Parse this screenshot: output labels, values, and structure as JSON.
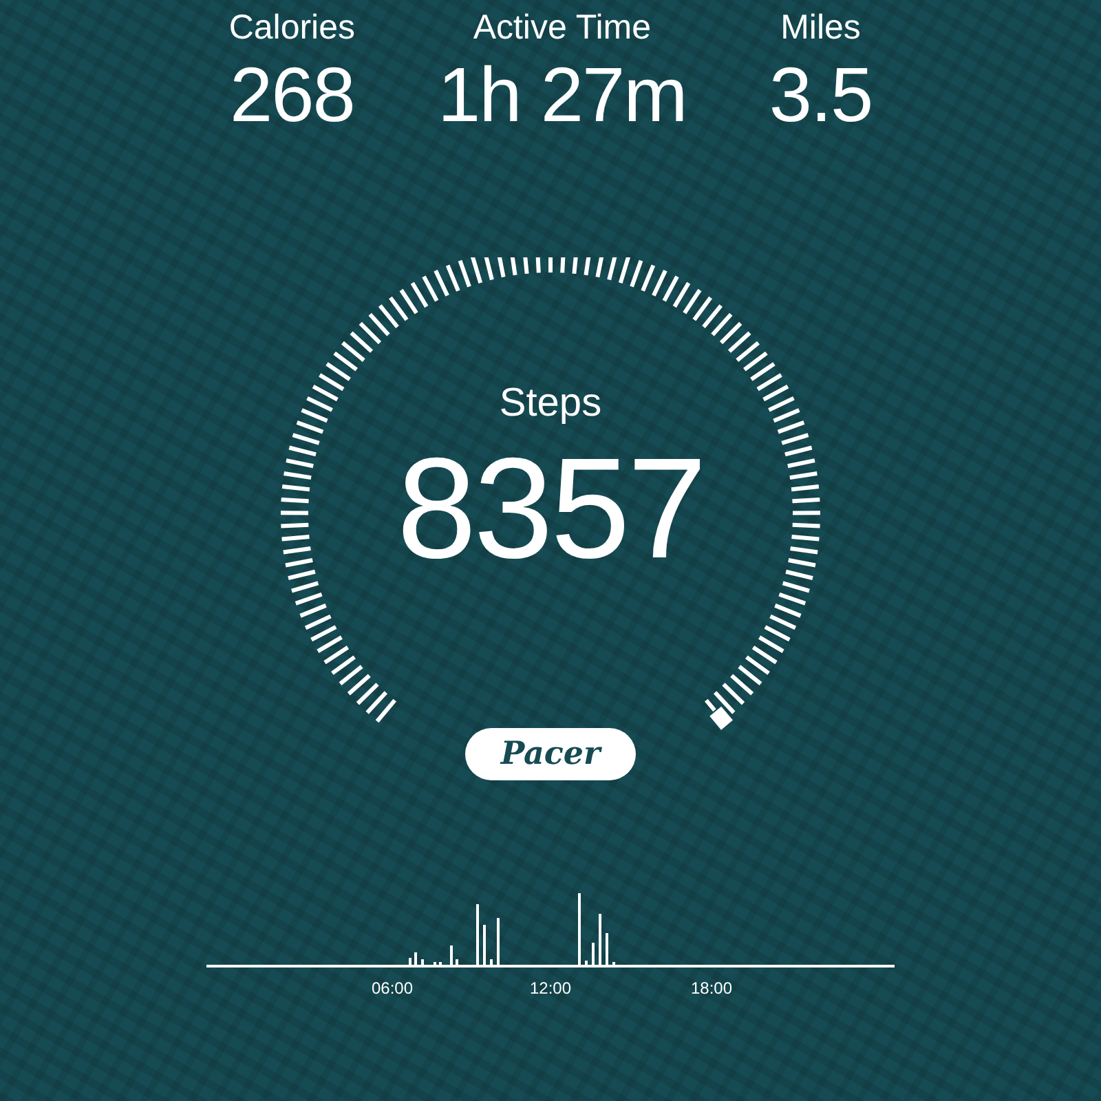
{
  "stats": [
    {
      "label": "Calories",
      "value": "268"
    },
    {
      "label": "Active Time",
      "value": "1h 27m"
    },
    {
      "label": "Miles",
      "value": "3.5"
    }
  ],
  "gauge": {
    "label": "Steps",
    "value": "8357"
  },
  "logo": {
    "text": "Pacer"
  },
  "activity_chart": {
    "x_labels": [
      "06:00",
      "12:00",
      "18:00"
    ]
  }
}
